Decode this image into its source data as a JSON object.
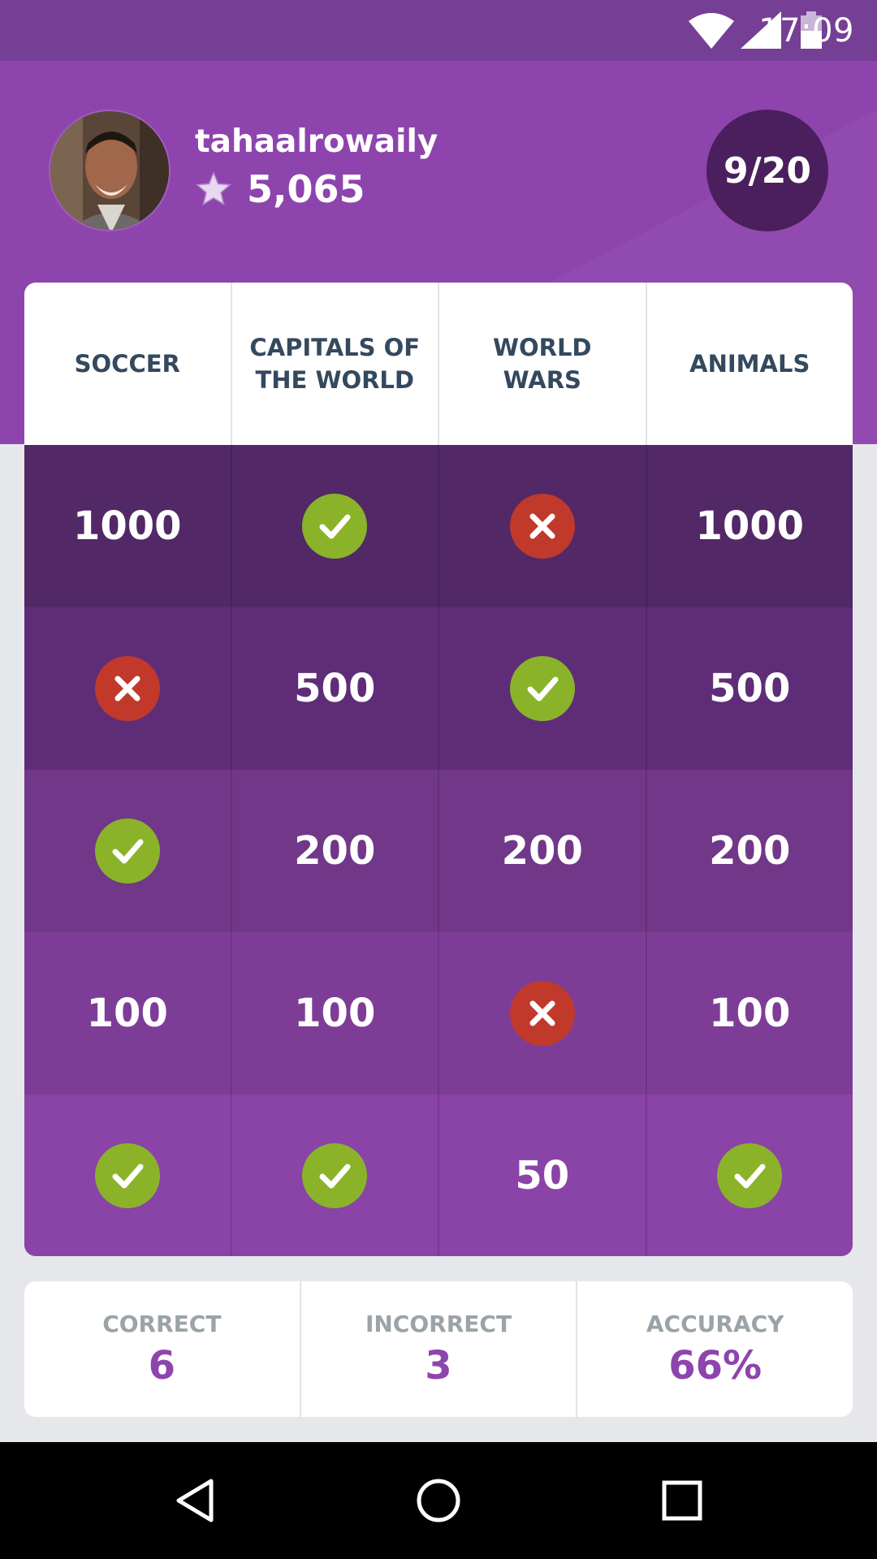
{
  "status_bar": {
    "time": "17:09",
    "icons": [
      "wifi-icon",
      "signal-icon",
      "battery-icon"
    ]
  },
  "profile": {
    "username": "tahaalrowaily",
    "points": "5,065",
    "progress": "9/20"
  },
  "categories": [
    "SOCCER",
    "CAPITALS OF THE WORLD",
    "WORLD WARS",
    "ANIMALS"
  ],
  "board": {
    "rows": [
      {
        "cells": [
          {
            "type": "value",
            "text": "1000"
          },
          {
            "type": "correct"
          },
          {
            "type": "wrong"
          },
          {
            "type": "value",
            "text": "1000"
          }
        ]
      },
      {
        "cells": [
          {
            "type": "wrong"
          },
          {
            "type": "value",
            "text": "500"
          },
          {
            "type": "correct"
          },
          {
            "type": "value",
            "text": "500"
          }
        ]
      },
      {
        "cells": [
          {
            "type": "correct"
          },
          {
            "type": "value",
            "text": "200"
          },
          {
            "type": "value",
            "text": "200"
          },
          {
            "type": "value",
            "text": "200"
          }
        ]
      },
      {
        "cells": [
          {
            "type": "value",
            "text": "100"
          },
          {
            "type": "value",
            "text": "100"
          },
          {
            "type": "wrong"
          },
          {
            "type": "value",
            "text": "100"
          }
        ]
      },
      {
        "cells": [
          {
            "type": "correct"
          },
          {
            "type": "correct"
          },
          {
            "type": "value",
            "text": "50"
          },
          {
            "type": "correct"
          }
        ]
      }
    ]
  },
  "stats": {
    "correct_label": "CORRECT",
    "correct_value": "6",
    "incorrect_label": "INCORRECT",
    "incorrect_value": "3",
    "accuracy_label": "ACCURACY",
    "accuracy_value": "66%"
  },
  "colors": {
    "header": "#8e44ad",
    "status_bar": "#743f95",
    "correct": "#8ab32a",
    "wrong": "#c0392b",
    "accent_text": "#8e44ad",
    "row_1": "#522867",
    "row_2": "#5f2d77",
    "row_3": "#713788",
    "row_4": "#7d3d97",
    "row_5": "#8a43a6"
  },
  "nav": [
    "back-icon",
    "home-icon",
    "recents-icon"
  ]
}
